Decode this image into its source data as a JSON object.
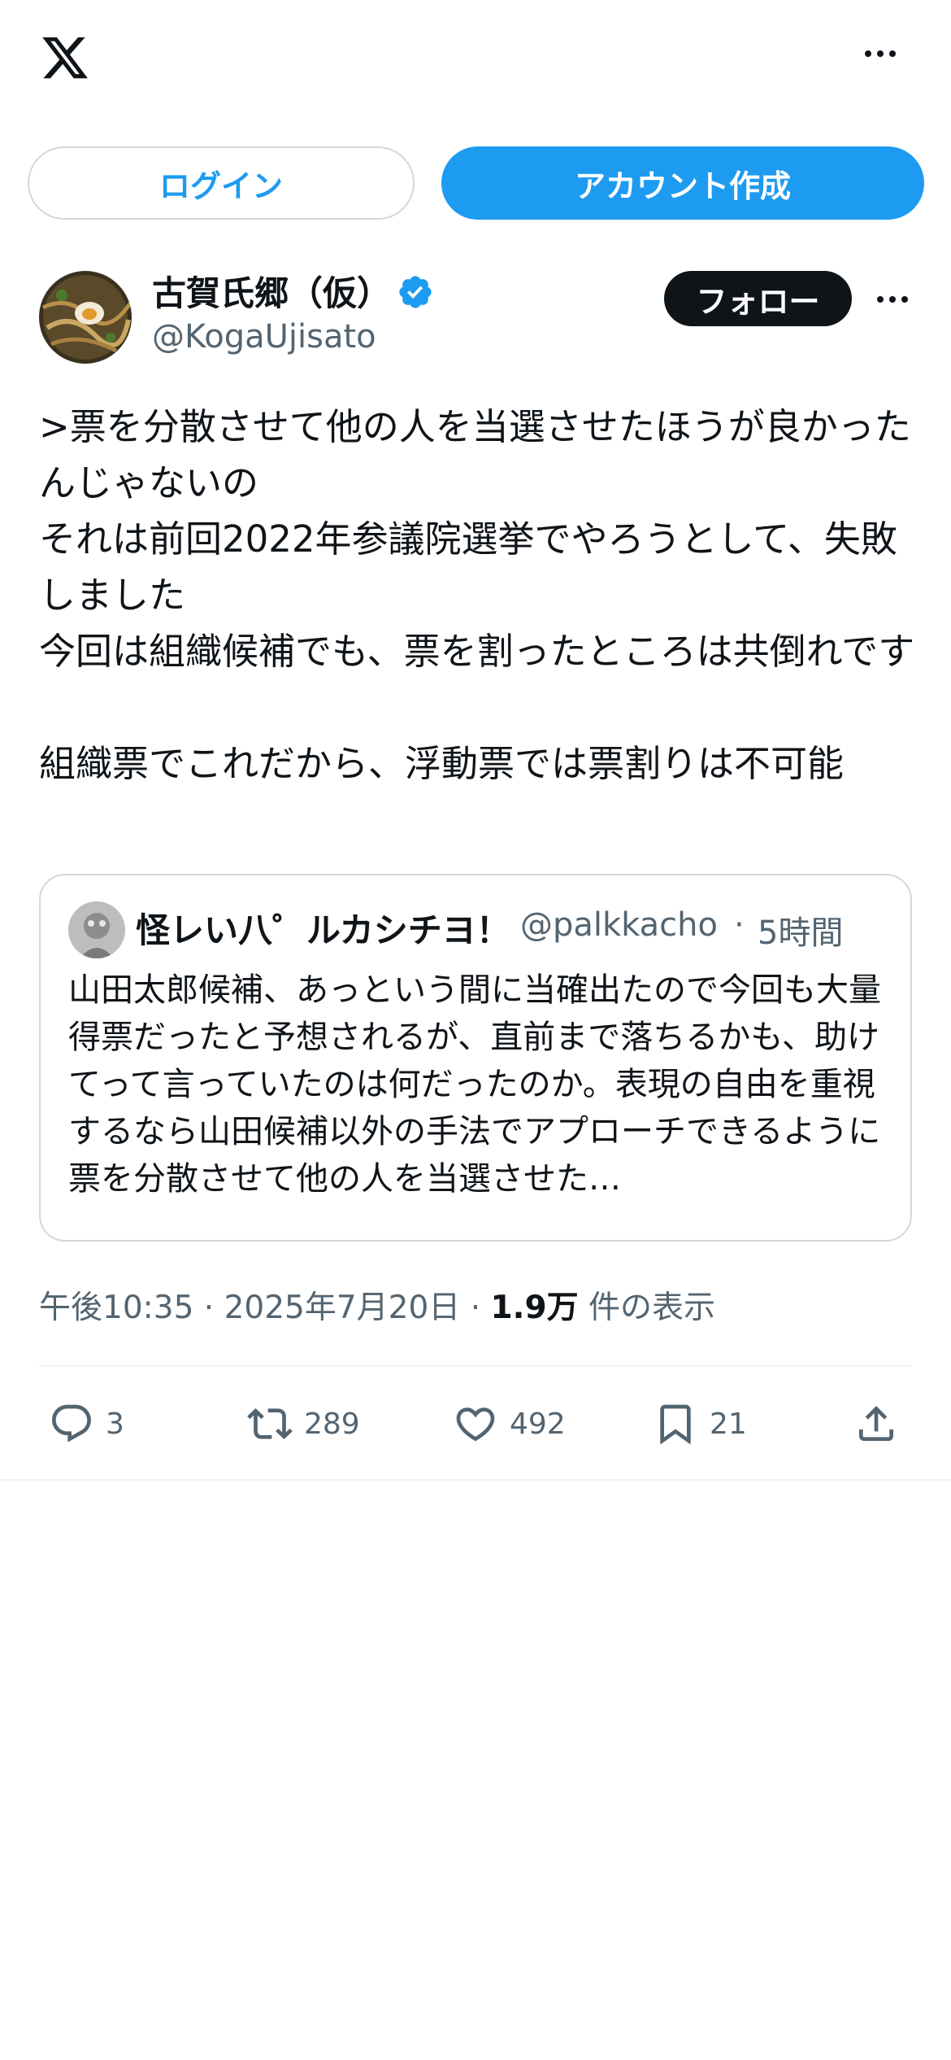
{
  "header": {
    "logo": "x-logo-icon",
    "more": "more-horizontal-icon"
  },
  "auth": {
    "login_label": "ログイン",
    "signup_label": "アカウント作成"
  },
  "author": {
    "name": "古賀氏郷（仮）",
    "handle": "@KogaUjisato",
    "verified_icon": "verified-badge-icon",
    "follow_label": "フォロー"
  },
  "tweet": {
    "text": ">票を分散させて他の人を当選させたほうが良かったんじゃないの\nそれは前回2022年参議院選挙でやろうとして、失敗しました\n今回は組織候補でも、票を割ったところは共倒れです\n\n組織票でこれだから、浮動票では票割りは不可能"
  },
  "quote": {
    "name": "怪レい八゜ルカシチヨ！",
    "handle": "@palkkacho",
    "separator": "·",
    "time": "5時間",
    "text": "山田太郎候補、あっという間に当確出たので今回も大量得票だったと予想されるが、直前まで落ちるかも、助けてって言っていたのは何だったのか。表現の自由を重視するなら山田候補以外の手法でアプローチできるように票を分散させて他の人を当選させた…"
  },
  "meta": {
    "time": "午後10:35",
    "sep1": " · ",
    "date": "2025年7月20日",
    "sep2": " · ",
    "views": "1.9万",
    "views_label": " 件の表示"
  },
  "actions": {
    "replies": "3",
    "retweets": "289",
    "likes": "492",
    "bookmarks": "21"
  },
  "colors": {
    "accent": "#1d9bf0",
    "text": "#0f1419",
    "muted": "#536471",
    "border": "#cfd9de"
  }
}
